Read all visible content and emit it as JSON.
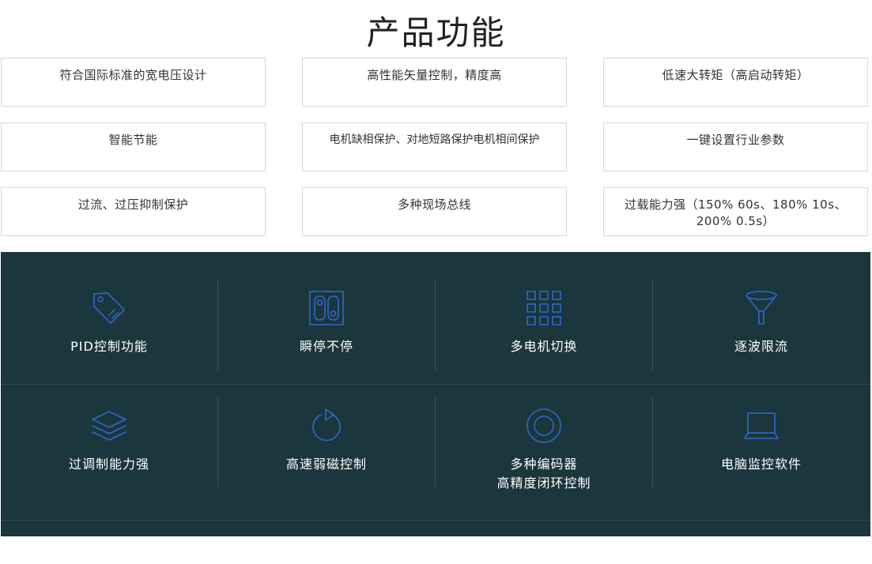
{
  "title": "产品功能",
  "features": [
    "符合国际标准的宽电压设计",
    "高性能矢量控制，精度高",
    "低速大转矩（高启动转矩）",
    "智能节能",
    "电机缺相保护、对地短路保护电机相间保护",
    "一键设置行业参数",
    "过流、过压抑制保护",
    "多种现场总线",
    "过载能力强（150% 60s、180% 10s、200% 0.5s）"
  ],
  "functions": [
    {
      "label": "PID控制功能",
      "icon": "tag-icon"
    },
    {
      "label": "瞬停不停",
      "icon": "switch-panel-icon"
    },
    {
      "label": "多电机切换",
      "icon": "grid-icon"
    },
    {
      "label": "逐波限流",
      "icon": "funnel-icon"
    },
    {
      "label": "过调制能力强",
      "icon": "layers-icon"
    },
    {
      "label": "高速弱磁控制",
      "icon": "refresh-icon"
    },
    {
      "label": "多种编码器",
      "label2": "高精度闭环控制",
      "icon": "ring-icon"
    },
    {
      "label": "电脑监控软件",
      "icon": "laptop-icon"
    }
  ],
  "colors": {
    "panel_background": "#1b363c",
    "icon_stroke": "#2e63b8",
    "box_border": "#d4d7e3"
  }
}
